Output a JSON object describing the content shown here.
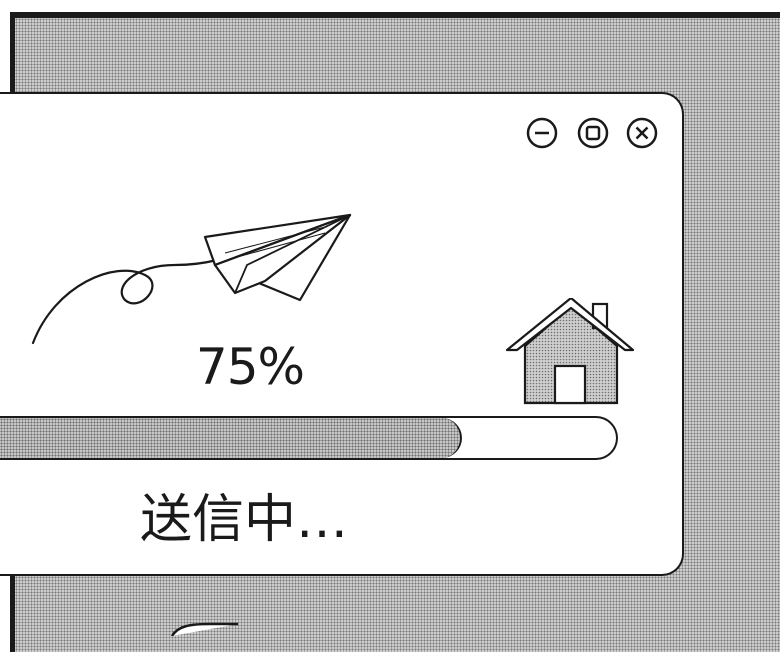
{
  "window": {
    "controls": {
      "minimize": "minimize-icon",
      "maximize": "maximize-icon",
      "close": "close-icon"
    }
  },
  "upload": {
    "progress_label": "75%",
    "progress_value": 0.75,
    "status": "送信中…"
  },
  "icons": {
    "airplane": "paper-airplane-icon",
    "home": "home-icon"
  },
  "colors": {
    "ink": "#1a1a1a",
    "screentone": "#c8c8c8",
    "background": "#ffffff"
  }
}
